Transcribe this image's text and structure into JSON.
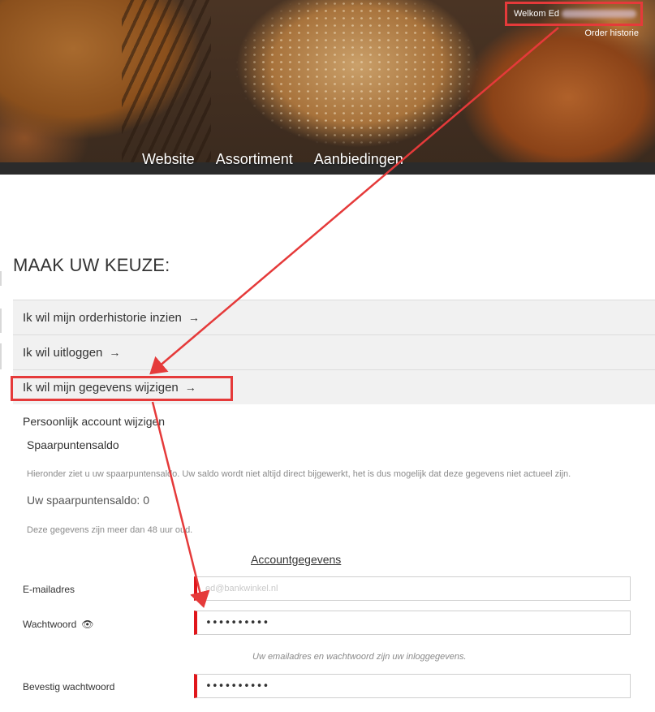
{
  "header": {
    "welcome_text": "Welkom Ed",
    "order_history_link": "Order historie",
    "nav": [
      "Website",
      "Assortiment",
      "Aanbiedingen"
    ]
  },
  "page_title": "MAAK UW KEUZE:",
  "accordion": [
    {
      "label": "Ik wil mijn orderhistorie inzien",
      "arrow": "→"
    },
    {
      "label": "Ik wil uitloggen",
      "arrow": "→"
    },
    {
      "label": "Ik wil mijn gegevens wijzigen",
      "arrow": "→"
    }
  ],
  "account": {
    "heading": "Persoonlijk account wijzigen",
    "points_title": "Spaarpuntensaldo",
    "points_note": "Hieronder ziet u uw spaarpuntensaldo. Uw saldo wordt niet altijd direct bijgewerkt, het is dus mogelijk dat deze gegevens niet actueel zijn.",
    "points_label": "Uw spaarpuntensaldo: 0",
    "age_note": "Deze gegevens zijn meer dan 48 uur oud.",
    "details_heading": "Accountgegevens",
    "email_label": "E-mailadres",
    "email_value": "ed@bankwinkel.nl",
    "password_label": "Wachtwoord",
    "password_value": "••••••••••",
    "login_hint": "Uw emailadres en wachtwoord zijn uw inloggegevens.",
    "confirm_label": "Bevestig wachtwoord",
    "confirm_value": "••••••••••"
  },
  "colors": {
    "highlight": "#e53a3a",
    "field_accent": "#e0161b",
    "accordion_bg": "#f1f1f1"
  },
  "icons": [
    "eye-icon",
    "arrow-right-icon"
  ]
}
